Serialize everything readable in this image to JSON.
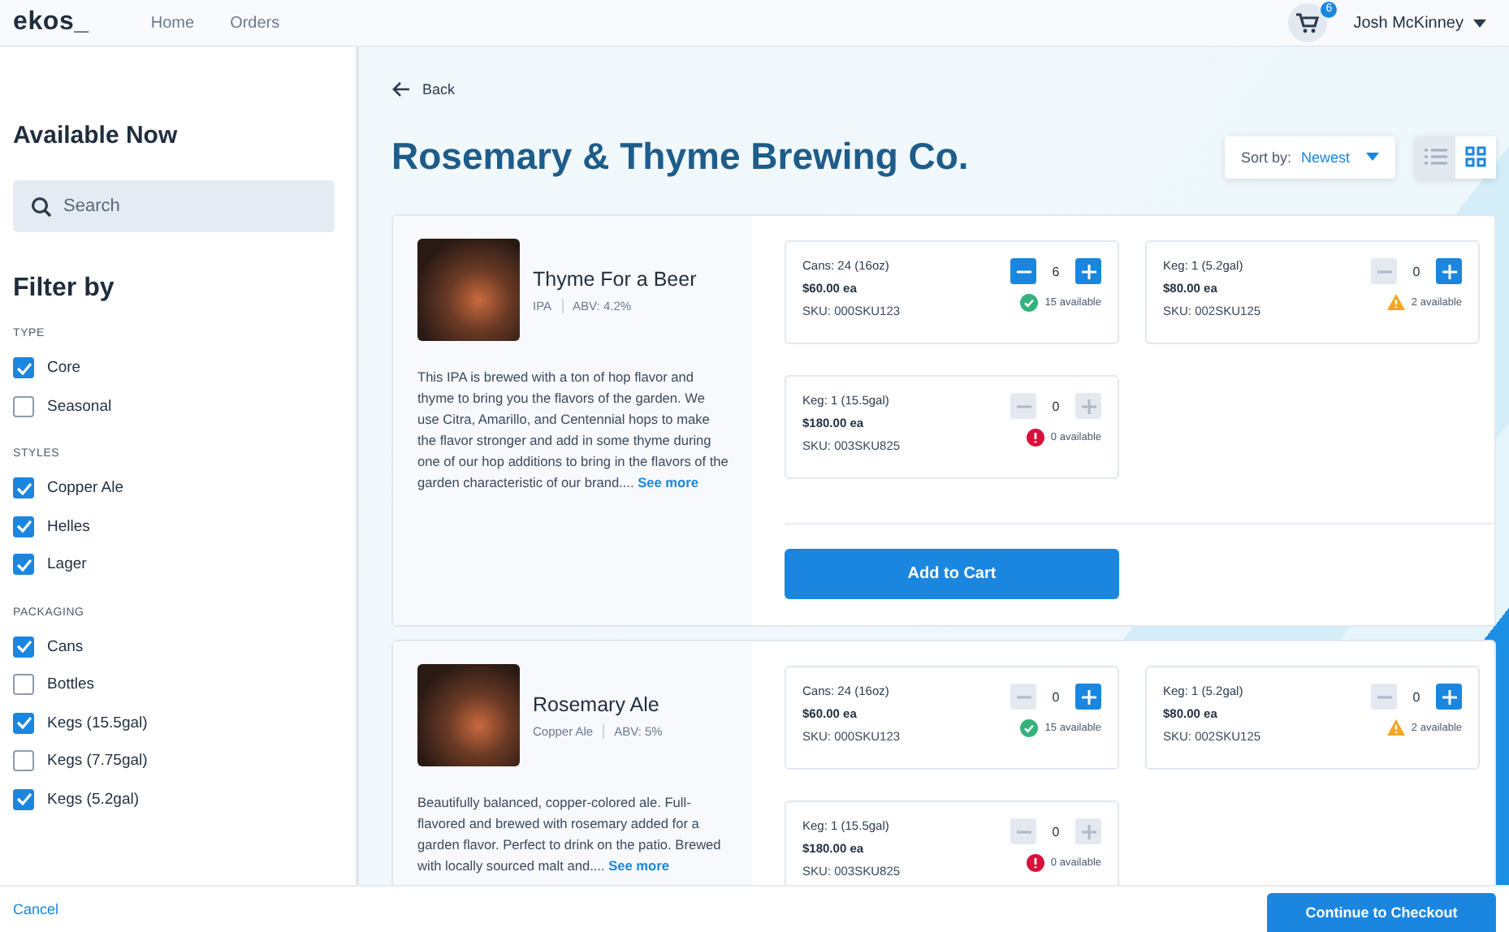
{
  "nav": {
    "logo": "ekos_",
    "links": [
      "Home",
      "Orders"
    ],
    "cart_count": "6",
    "user": "Josh McKinney"
  },
  "sidebar": {
    "title": "Available Now",
    "search": {
      "placeholder": "Search"
    },
    "filter_title": "Filter by",
    "groups": [
      {
        "label": "TYPE",
        "options": [
          {
            "label": "Core",
            "checked": true
          },
          {
            "label": "Seasonal",
            "checked": false
          }
        ]
      },
      {
        "label": "STYLES",
        "options": [
          {
            "label": "Copper Ale",
            "checked": true
          },
          {
            "label": "Helles",
            "checked": true
          },
          {
            "label": "Lager",
            "checked": true
          }
        ]
      },
      {
        "label": "PACKAGING",
        "options": [
          {
            "label": "Cans",
            "checked": true
          },
          {
            "label": "Bottles",
            "checked": false
          },
          {
            "label": "Kegs (15.5gal)",
            "checked": true
          },
          {
            "label": "Kegs (7.75gal)",
            "checked": false
          },
          {
            "label": "Kegs (5.2gal)",
            "checked": true
          }
        ]
      }
    ]
  },
  "main": {
    "back": "Back",
    "title": "Rosemary & Thyme Brewing Co.",
    "sort": {
      "label": "Sort by:",
      "value": "Newest"
    },
    "views": [
      {
        "kind": "list",
        "selected": false
      },
      {
        "kind": "grid",
        "selected": true
      }
    ],
    "products": [
      {
        "name": "Thyme For a Beer",
        "style": "IPA",
        "abv": "ABV: 4.2%",
        "description": "This IPA is brewed with a ton of hop flavor and thyme to bring you the flavors of the garden. We use Citra, Amarillo, and Centennial hops to make the flavor stronger and add in some thyme during one of our hop additions to bring in the flavors of the garden characteristic of our brand....",
        "see_more": "See more",
        "variants": [
          {
            "package": "Cans: 24 (16oz)",
            "price": "$60.00 ea",
            "sku": "SKU: 000SKU123",
            "quantity": "6",
            "minus_disabled": false,
            "plus_disabled": false,
            "kind": "ok",
            "availability": "15 available"
          },
          {
            "package": "Keg: 1 (5.2gal)",
            "price": "$80.00 ea",
            "sku": "SKU: 002SKU125",
            "quantity": "0",
            "minus_disabled": true,
            "plus_disabled": false,
            "kind": "warning",
            "availability": "2 available"
          },
          {
            "package": "Keg: 1 (15.5gal)",
            "price": "$180.00 ea",
            "sku": "SKU: 003SKU825",
            "quantity": "0",
            "minus_disabled": true,
            "plus_disabled": true,
            "kind": "error",
            "availability": "0 available"
          }
        ],
        "add_to_cart": "Add to Cart"
      },
      {
        "name": "Rosemary Ale",
        "style": "Copper Ale",
        "abv": "ABV: 5%",
        "description": "Beautifully balanced, copper-colored ale. Full-flavored and brewed with rosemary added for a garden flavor. Perfect to drink on the patio. Brewed with locally sourced malt and....",
        "see_more": "See more",
        "variants": [
          {
            "package": "Cans: 24 (16oz)",
            "price": "$60.00 ea",
            "sku": "SKU: 000SKU123",
            "quantity": "0",
            "minus_disabled": true,
            "plus_disabled": false,
            "kind": "ok",
            "availability": "15 available"
          },
          {
            "package": "Keg: 1 (5.2gal)",
            "price": "$80.00 ea",
            "sku": "SKU: 002SKU125",
            "quantity": "0",
            "minus_disabled": true,
            "plus_disabled": false,
            "kind": "warning",
            "availability": "2 available"
          },
          {
            "package": "Keg: 1 (15.5gal)",
            "price": "$180.00 ea",
            "sku": "SKU: 003SKU825",
            "quantity": "0",
            "minus_disabled": true,
            "plus_disabled": true,
            "kind": "error",
            "availability": "0 available"
          }
        ]
      }
    ]
  },
  "footer": {
    "cancel": "Cancel",
    "checkout": "Continue to Checkout"
  }
}
